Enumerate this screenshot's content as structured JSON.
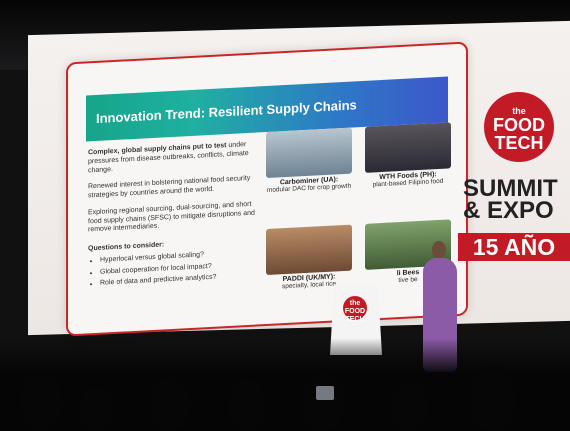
{
  "slide": {
    "title": "Innovation Trend: Resilient Supply Chains",
    "paragraphs": [
      {
        "bold": "Complex, global supply chains put to test",
        "text": " under pressures from disease outbreaks, conflicts, climate change."
      },
      {
        "bold": "",
        "text": "Renewed interest in bolstering national food security strategies by countries around the world."
      },
      {
        "bold": "",
        "text": "Exploring regional sourcing, dual-sourcing, and short food supply chains (SFSC) to mitigate disruptions and remove intermediaries."
      }
    ],
    "questions_title": "Questions to consider:",
    "questions": [
      "Hyperlocal versus global scaling?",
      "Global cooperation for local impact?",
      "Role of data and predictive analytics?"
    ],
    "cards": [
      {
        "title": "Carbominer (UA):",
        "subtitle": "modular DAC for crop growth",
        "color": "#8ea7b6"
      },
      {
        "title": "WTH Foods (PH):",
        "subtitle": "plant-based Filipino food",
        "color": "#5f5b63"
      },
      {
        "title": "PADDI (UK/MY):",
        "subtitle": "specialty, local rice",
        "color": "#9d6b4d"
      },
      {
        "title": "li Bees",
        "subtitle": "tive be",
        "color": "#5a7a4a"
      }
    ]
  },
  "brand": {
    "logo_top": "the",
    "logo_mid": "FOOD",
    "logo_bottom": "TECH",
    "summit_line1": "SUMMIT",
    "summit_line2": "& EXPO",
    "anniversary": "15 AÑO",
    "accent": "#c31b26"
  },
  "podium": {
    "logo_top": "the",
    "logo_mid": "FOOD",
    "logo_bottom": "TECH"
  }
}
